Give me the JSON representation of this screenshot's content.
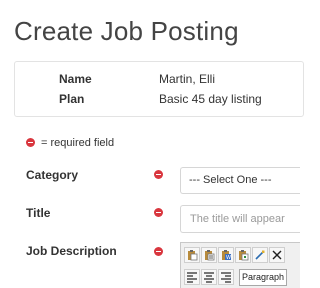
{
  "page": {
    "title": "Create Job Posting"
  },
  "summary": {
    "name_label": "Name",
    "name_value": "Martin, Elli",
    "plan_label": "Plan",
    "plan_value": "Basic 45 day listing"
  },
  "legend": {
    "text": "= required field"
  },
  "form": {
    "category": {
      "label": "Category",
      "selected": "--- Select One ---"
    },
    "title": {
      "label": "Title",
      "placeholder": "The title will appear"
    },
    "description": {
      "label": "Job Description",
      "toolbar_icons": [
        "paste-icon",
        "paste-text-icon",
        "paste-word-icon",
        "paste-special-icon",
        "spellcheck-icon",
        "remove-format-icon"
      ],
      "align_icons": [
        "align-left-icon",
        "align-center-icon",
        "align-right-icon"
      ],
      "format_value": "Paragraph"
    }
  },
  "colors": {
    "required": "#d9363e",
    "title_text": "#444444"
  }
}
